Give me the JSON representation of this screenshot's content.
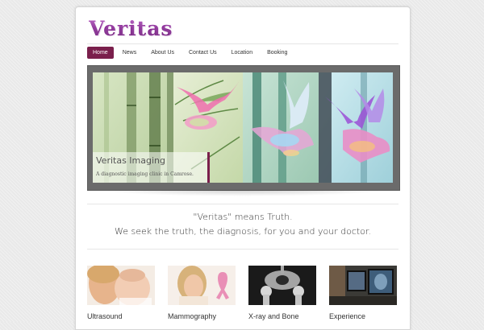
{
  "site": {
    "logo_text": "Veritas"
  },
  "nav": {
    "items": [
      {
        "label": "Home",
        "active": true
      },
      {
        "label": "News",
        "active": false
      },
      {
        "label": "About Us",
        "active": false
      },
      {
        "label": "Contact Us",
        "active": false
      },
      {
        "label": "Location",
        "active": false
      },
      {
        "label": "Booking",
        "active": false
      }
    ]
  },
  "slider": {
    "caption_title": "Veritas Imaging",
    "caption_subtitle": "A diagnostic imaging clinic in Camrose."
  },
  "tagline": {
    "line1": "\"Veritas\" means Truth.",
    "line2": "We seek the truth, the diagnosis, for you and your doctor."
  },
  "services": [
    {
      "label": "Ultrasound",
      "image": "mother-and-baby-photo"
    },
    {
      "label": "Mammography",
      "image": "woman-with-pink-ribbon-photo"
    },
    {
      "label": "X-ray and Bone",
      "image": "pelvis-xray-photo"
    },
    {
      "label": "Experience",
      "image": "radiologist-monitors-photo"
    }
  ],
  "colors": {
    "accent": "#7a1f4c",
    "logo": "#8a2b95",
    "slider_frame": "#6b6b6b"
  }
}
